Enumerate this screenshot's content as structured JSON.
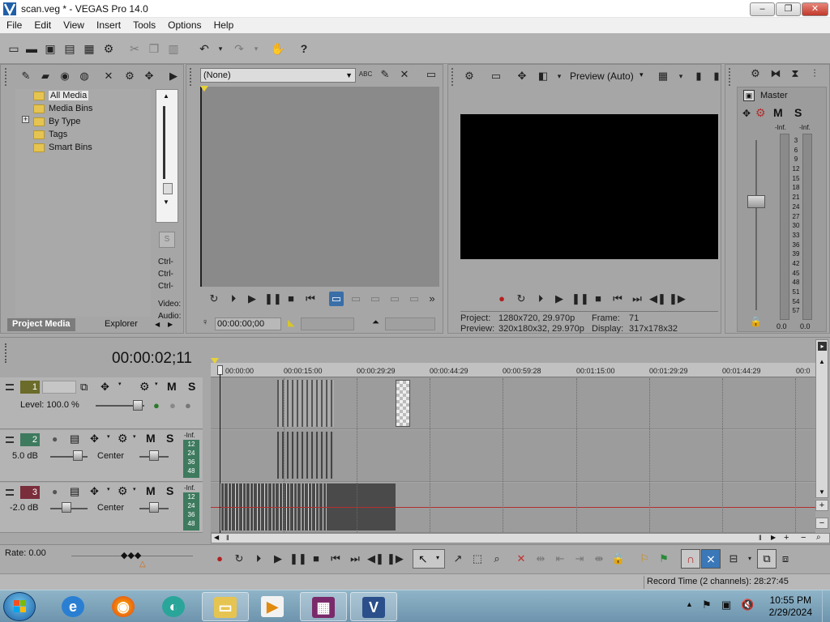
{
  "window": {
    "title": "scan.veg * - VEGAS Pro 14.0",
    "minimize": "–",
    "maximize": "❐",
    "close": "✕"
  },
  "menu": [
    "File",
    "Edit",
    "View",
    "Insert",
    "Tools",
    "Options",
    "Help"
  ],
  "project_media": {
    "tree": [
      {
        "label": "All Media",
        "selected": true
      },
      {
        "label": "Media Bins"
      },
      {
        "label": "By Type",
        "expander": "+"
      },
      {
        "label": "Tags"
      },
      {
        "label": "Smart Bins"
      }
    ],
    "side_labels": [
      "Ctrl-",
      "Ctrl-",
      "Ctrl-",
      "Video:",
      "Audio:"
    ],
    "tabs": [
      "Project Media",
      "Explorer"
    ]
  },
  "trimmer": {
    "dropdown_value": "(None)",
    "timecode": "00:00:00;00"
  },
  "preview": {
    "mode": "Preview (Auto)",
    "project_label": "Project:",
    "project_value": "1280x720, 29.970p",
    "preview_label": "Preview:",
    "preview_value": "320x180x32, 29.970p",
    "frame_label": "Frame:",
    "frame_value": "71",
    "display_label": "Display:",
    "display_value": "317x178x32"
  },
  "master": {
    "title": "Master",
    "mute": "M",
    "solo": "S",
    "inf_left": "-Inf.",
    "inf_right": "-Inf.",
    "scale": [
      "3",
      "6",
      "9",
      "12",
      "15",
      "18",
      "21",
      "24",
      "27",
      "30",
      "33",
      "36",
      "39",
      "42",
      "45",
      "48",
      "51",
      "54",
      "57"
    ],
    "readout_left": "0.0",
    "readout_right": "0.0"
  },
  "timeline": {
    "timecode": "00:00:02;11",
    "ruler_ticks": [
      "00:00:00",
      "00:00:15:00",
      "00:00:29:29",
      "00:00:44:29",
      "00:00:59:28",
      "00:01:15:00",
      "00:01:29:29",
      "00:01:44:29",
      "00:0"
    ],
    "tracks": [
      {
        "num": "1",
        "type": "video",
        "level_label": "Level: 100.0 %",
        "m": "M",
        "s": "S"
      },
      {
        "num": "2",
        "type": "audio",
        "volume": "5.0 dB",
        "pan": "Center",
        "inf": "-Inf.",
        "scale": [
          "12",
          "24",
          "36",
          "48"
        ],
        "m": "M",
        "s": "S"
      },
      {
        "num": "3",
        "type": "audio",
        "volume": "-2.0 dB",
        "pan": "Center",
        "inf": "-Inf.",
        "scale": [
          "12",
          "24",
          "36",
          "48"
        ],
        "m": "M",
        "s": "S"
      }
    ]
  },
  "rate_label": "Rate: 0.00",
  "status": {
    "record_time": "Record Time (2 channels): 28:27:45"
  },
  "taskbar": {
    "time": "10:55 PM",
    "date": "2/29/2024"
  },
  "colors": {
    "track1": "#6b6b2a",
    "track2": "#3e7a5e",
    "track3": "#7a2d3b",
    "cursor_line": "#b23030",
    "taskbar": "#7fa6bd"
  }
}
